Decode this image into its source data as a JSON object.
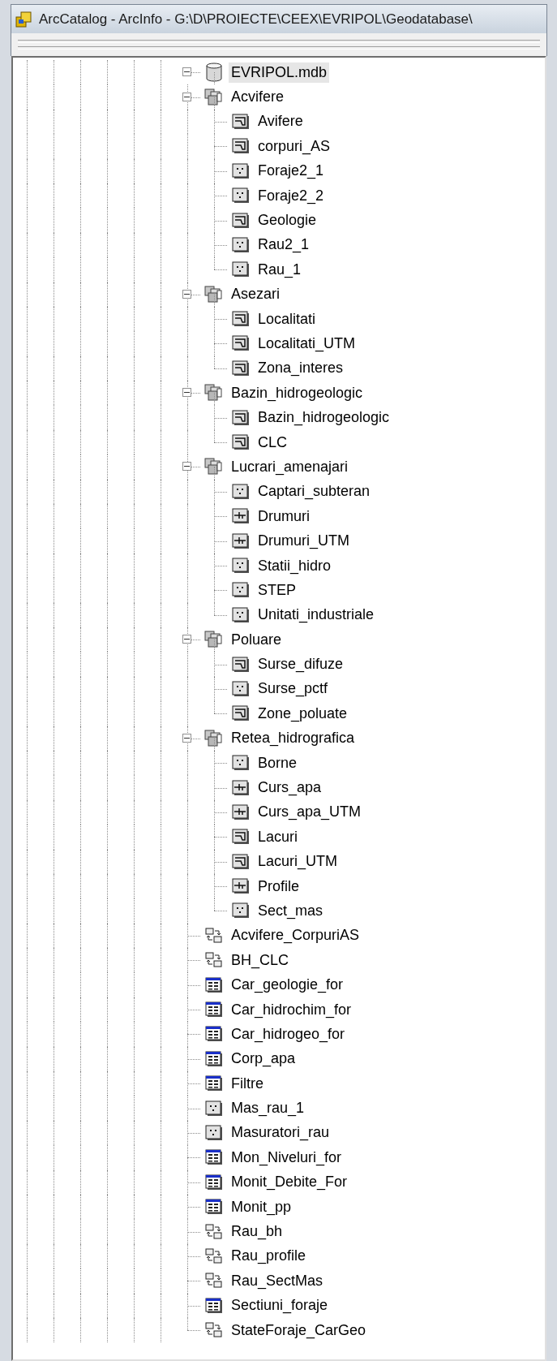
{
  "window": {
    "title": "ArcCatalog - ArcInfo - G:\\D\\PROIECTE\\CEEX\\EVRIPOL\\Geodatabase\\"
  },
  "tree": {
    "label": "EVRIPOL.mdb",
    "kind": "database",
    "expanded": true,
    "selected": true,
    "children": [
      {
        "label": "Acvifere",
        "kind": "dataset",
        "expanded": true,
        "selected": false,
        "children": [
          {
            "label": "Avifere",
            "kind": "polygon",
            "selected": false
          },
          {
            "label": "corpuri_AS",
            "kind": "polygon",
            "selected": false
          },
          {
            "label": "Foraje2_1",
            "kind": "point",
            "selected": false
          },
          {
            "label": "Foraje2_2",
            "kind": "point",
            "selected": false
          },
          {
            "label": "Geologie",
            "kind": "polygon",
            "selected": false
          },
          {
            "label": "Rau2_1",
            "kind": "point",
            "selected": false
          },
          {
            "label": "Rau_1",
            "kind": "point",
            "selected": false
          }
        ]
      },
      {
        "label": "Asezari",
        "kind": "dataset",
        "expanded": true,
        "selected": false,
        "children": [
          {
            "label": "Localitati",
            "kind": "polygon",
            "selected": false
          },
          {
            "label": "Localitati_UTM",
            "kind": "polygon",
            "selected": false
          },
          {
            "label": "Zona_interes",
            "kind": "polygon",
            "selected": false
          }
        ]
      },
      {
        "label": "Bazin_hidrogeologic",
        "kind": "dataset",
        "expanded": true,
        "selected": false,
        "children": [
          {
            "label": "Bazin_hidrogeologic",
            "kind": "polygon",
            "selected": false
          },
          {
            "label": "CLC",
            "kind": "polygon",
            "selected": false
          }
        ]
      },
      {
        "label": "Lucrari_amenajari",
        "kind": "dataset",
        "expanded": true,
        "selected": false,
        "children": [
          {
            "label": "Captari_subteran",
            "kind": "point",
            "selected": false
          },
          {
            "label": "Drumuri",
            "kind": "line",
            "selected": false
          },
          {
            "label": "Drumuri_UTM",
            "kind": "line",
            "selected": false
          },
          {
            "label": "Statii_hidro",
            "kind": "point",
            "selected": false
          },
          {
            "label": "STEP",
            "kind": "point",
            "selected": false
          },
          {
            "label": "Unitati_industriale",
            "kind": "point",
            "selected": false
          }
        ]
      },
      {
        "label": "Poluare",
        "kind": "dataset",
        "expanded": true,
        "selected": false,
        "children": [
          {
            "label": "Surse_difuze",
            "kind": "polygon",
            "selected": false
          },
          {
            "label": "Surse_pctf",
            "kind": "point",
            "selected": false
          },
          {
            "label": "Zone_poluate",
            "kind": "polygon",
            "selected": false
          }
        ]
      },
      {
        "label": "Retea_hidrografica",
        "kind": "dataset",
        "expanded": true,
        "selected": false,
        "children": [
          {
            "label": "Borne",
            "kind": "point",
            "selected": false
          },
          {
            "label": "Curs_apa",
            "kind": "line",
            "selected": false
          },
          {
            "label": "Curs_apa_UTM",
            "kind": "line",
            "selected": false
          },
          {
            "label": "Lacuri",
            "kind": "polygon",
            "selected": false
          },
          {
            "label": "Lacuri_UTM",
            "kind": "polygon",
            "selected": false
          },
          {
            "label": "Profile",
            "kind": "line",
            "selected": false
          },
          {
            "label": "Sect_mas",
            "kind": "point",
            "selected": false
          }
        ]
      },
      {
        "label": "Acvifere_CorpuriAS",
        "kind": "relationship",
        "selected": false
      },
      {
        "label": "BH_CLC",
        "kind": "relationship",
        "selected": false
      },
      {
        "label": "Car_geologie_for",
        "kind": "table",
        "selected": false
      },
      {
        "label": "Car_hidrochim_for",
        "kind": "table",
        "selected": false
      },
      {
        "label": "Car_hidrogeo_for",
        "kind": "table",
        "selected": false
      },
      {
        "label": "Corp_apa",
        "kind": "table",
        "selected": false
      },
      {
        "label": "Filtre",
        "kind": "table",
        "selected": false
      },
      {
        "label": "Mas_rau_1",
        "kind": "point",
        "selected": false
      },
      {
        "label": "Masuratori_rau",
        "kind": "point",
        "selected": false
      },
      {
        "label": "Mon_Niveluri_for",
        "kind": "table",
        "selected": false
      },
      {
        "label": "Monit_Debite_For",
        "kind": "table",
        "selected": false
      },
      {
        "label": "Monit_pp",
        "kind": "table",
        "selected": false
      },
      {
        "label": "Rau_bh",
        "kind": "relationship",
        "selected": false
      },
      {
        "label": "Rau_profile",
        "kind": "relationship",
        "selected": false
      },
      {
        "label": "Rau_SectMas",
        "kind": "relationship",
        "selected": false
      },
      {
        "label": "Sectiuni_foraje",
        "kind": "table",
        "selected": false
      },
      {
        "label": "StateForaje_CarGeo",
        "kind": "relationship",
        "selected": false
      }
    ]
  }
}
